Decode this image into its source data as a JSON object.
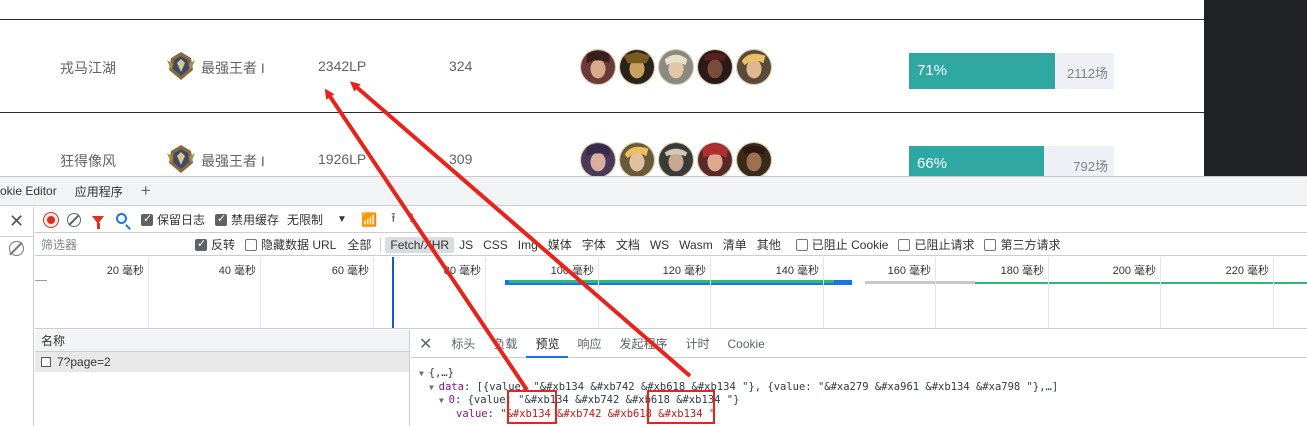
{
  "ranking": {
    "rows": [
      {
        "name": "戎马江湖",
        "rank": "最强王者 I",
        "lp": "2342LP",
        "wins": "324",
        "win_rate": "71%",
        "win_rate_value": 0.71,
        "games": "2112场"
      },
      {
        "name": "狂得像风",
        "rank": "最强王者 I",
        "lp": "1926LP",
        "wins": "309",
        "win_rate": "66%",
        "win_rate_value": 0.66,
        "games": "792场"
      }
    ]
  },
  "devtools": {
    "panel_tabs": [
      "okie Editor",
      "应用程序"
    ],
    "toolbar": {
      "preserve_log": "保留日志",
      "disable_cache": "禁用缓存",
      "throttle": "无限制"
    },
    "filter": {
      "placeholder": "筛选器",
      "invert": "反转",
      "hide_data_urls": "隐藏数据 URL",
      "types": [
        "全部",
        "Fetch/XHR",
        "JS",
        "CSS",
        "Img",
        "媒体",
        "字体",
        "文档",
        "WS",
        "Wasm",
        "清单",
        "其他"
      ],
      "selected_type": "Fetch/XHR",
      "blocked_cookies": "已阻止 Cookie",
      "blocked_requests": "已阻止请求",
      "third_party": "第三方请求"
    },
    "timeline_ticks": [
      "20 毫秒",
      "40 毫秒",
      "60 毫秒",
      "80 毫秒",
      "100 毫秒",
      "120 毫秒",
      "140 毫秒",
      "160 毫秒",
      "180 毫秒",
      "200 毫秒",
      "220 毫秒"
    ],
    "request_list": {
      "header": "名称",
      "items": [
        "7?page=2"
      ]
    },
    "detail_tabs": [
      "标头",
      "负载",
      "预览",
      "响应",
      "发起程序",
      "计时",
      "Cookie"
    ],
    "active_detail_tab": "预览",
    "preview_lines": {
      "l1": "{,…}",
      "l2_key": "data",
      "l2_val": ": [{value: \"&#xb134 &#xb742 &#xb618 &#xb134 \"}, {value: \"&#xa279 &#xa961 &#xb134 &#xa798 \"},…]",
      "l3_key": "0",
      "l3_val": ": {value: \"&#xb134 &#xb742 &#xb618 &#xb134 \"}",
      "l4_key": "value",
      "l4_val": "\"&#xb134 &#xb742 &#xb618 &#xb134 \""
    }
  },
  "colors": {
    "win_bar": "#2ea8a0",
    "highlight_red": "#e8231b"
  },
  "icons": {
    "rank": "challenger-rank-icon",
    "hero": "champion-portrait-icon"
  }
}
